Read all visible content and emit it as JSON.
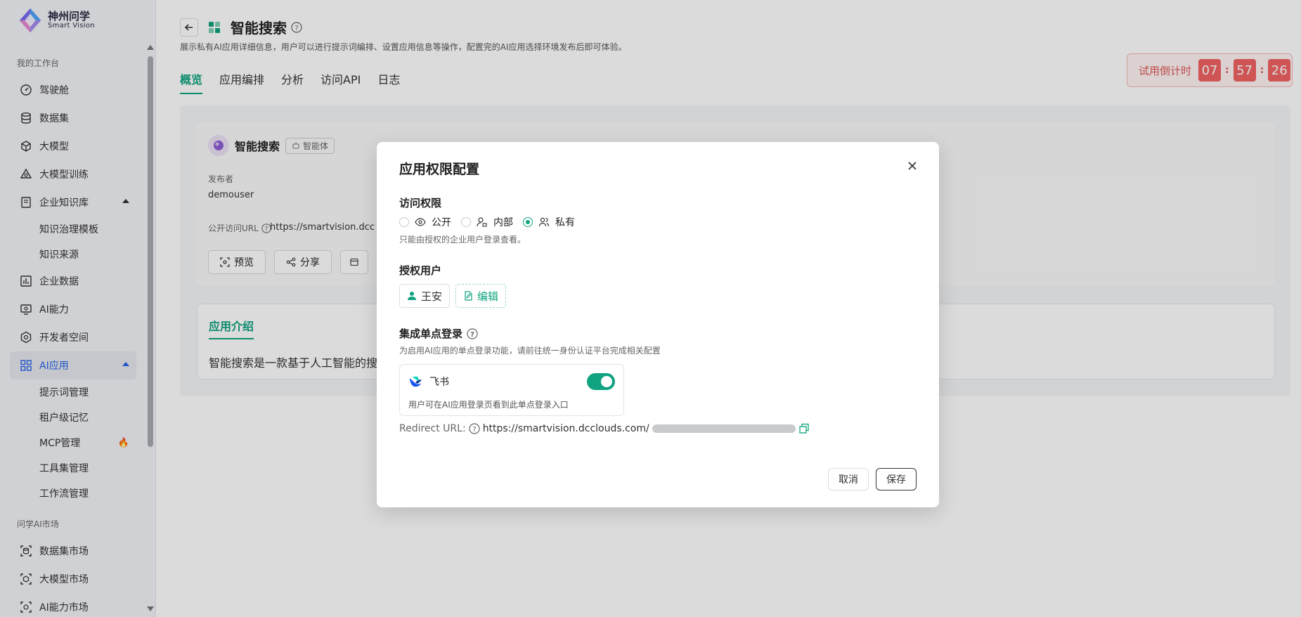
{
  "brand": {
    "name_cn": "神州问学",
    "name_en": "Smart Vision",
    "accent": "#10a37f",
    "link_active": "#2563eb"
  },
  "sidebar": {
    "section_workbench": "我的工作台",
    "section_market": "问学AI市场",
    "items": [
      {
        "label": "驾驶舱",
        "icon": "dashboard-icon"
      },
      {
        "label": "数据集",
        "icon": "database-icon"
      },
      {
        "label": "大模型",
        "icon": "cube-icon"
      },
      {
        "label": "大模型训练",
        "icon": "training-icon"
      },
      {
        "label": "企业知识库",
        "icon": "book-icon",
        "expanded": true
      },
      {
        "label": "知识治理模板",
        "sub": true
      },
      {
        "label": "知识来源",
        "sub": true
      },
      {
        "label": "企业数据",
        "icon": "chart-icon"
      },
      {
        "label": "AI能力",
        "icon": "monitor-icon"
      },
      {
        "label": "开发者空间",
        "icon": "hexagon-icon"
      },
      {
        "label": "AI应用",
        "icon": "grid-icon",
        "active": true,
        "expanded": true
      },
      {
        "label": "提示词管理",
        "sub": true
      },
      {
        "label": "租户级记忆",
        "sub": true
      },
      {
        "label": "MCP管理",
        "sub": true,
        "hot": true
      },
      {
        "label": "工具集管理",
        "sub": true
      },
      {
        "label": "工作流管理",
        "sub": true
      }
    ],
    "market_items": [
      {
        "label": "数据集市场"
      },
      {
        "label": "大模型市场"
      },
      {
        "label": "AI能力市场"
      }
    ]
  },
  "page": {
    "title": "智能搜索",
    "description": "展示私有AI应用详细信息，用户可以进行提示词编排、设置应用信息等操作，配置完的AI应用选择环境发布后即可体验。",
    "tabs": [
      "概览",
      "应用编排",
      "分析",
      "访问API",
      "日志"
    ],
    "active_tab": 0
  },
  "countdown": {
    "label": "试用倒计时",
    "hours": "07",
    "minutes": "57",
    "seconds": "26"
  },
  "app_info": {
    "name": "智能搜索",
    "tag": "智能体",
    "publisher_label": "发布者",
    "publisher": "demouser",
    "url_label": "公开访问URL",
    "url": "https://smartvision.dcc",
    "actions": [
      "预览",
      "分享"
    ],
    "intro_title": "应用介绍",
    "intro_text": "智能搜索是一款基于人工智能的搜"
  },
  "modal": {
    "title": "应用权限配置",
    "access_title": "访问权限",
    "access_options": [
      {
        "label": "公开",
        "checked": false
      },
      {
        "label": "内部",
        "checked": false
      },
      {
        "label": "私有",
        "checked": true
      }
    ],
    "access_hint": "只能由授权的企业用户登录查看。",
    "users_title": "授权用户",
    "user_name": "王安",
    "edit_label": "编辑",
    "sso_title": "集成单点登录",
    "sso_hint": "为启用AI应用的单点登录功能，请前往统一身份认证平台完成相关配置",
    "sso_provider": "飞书",
    "sso_enabled": true,
    "sso_desc": "用户可在AI应用登录页看到此单点登录入口",
    "redirect_label": "Redirect URL:",
    "redirect_url": "https://smartvision.dcclouds.com/",
    "cancel": "取消",
    "save": "保存"
  }
}
